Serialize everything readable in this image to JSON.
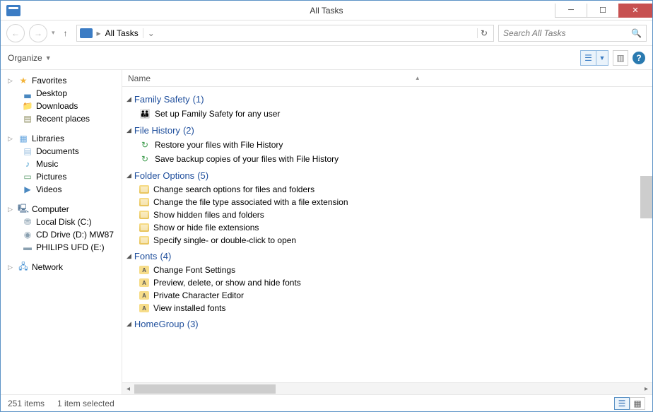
{
  "window": {
    "title": "All Tasks"
  },
  "nav": {
    "location": "All Tasks",
    "search_placeholder": "Search All Tasks"
  },
  "toolbar": {
    "organize": "Organize"
  },
  "columns": {
    "name": "Name"
  },
  "sidebar": {
    "favorites": {
      "label": "Favorites",
      "items": [
        {
          "label": "Desktop"
        },
        {
          "label": "Downloads"
        },
        {
          "label": "Recent places"
        }
      ]
    },
    "libraries": {
      "label": "Libraries",
      "items": [
        {
          "label": "Documents"
        },
        {
          "label": "Music"
        },
        {
          "label": "Pictures"
        },
        {
          "label": "Videos"
        }
      ]
    },
    "computer": {
      "label": "Computer",
      "items": [
        {
          "label": "Local Disk (C:)"
        },
        {
          "label": "CD Drive (D:) MW87"
        },
        {
          "label": "PHILIPS UFD (E:)"
        }
      ]
    },
    "network": {
      "label": "Network"
    }
  },
  "groups": [
    {
      "title": "Family Safety",
      "count": "(1)",
      "icon": "safety",
      "items": [
        {
          "label": "Set up Family Safety for any user"
        }
      ]
    },
    {
      "title": "File History",
      "count": "(2)",
      "icon": "hist",
      "items": [
        {
          "label": "Restore your files with File History"
        },
        {
          "label": "Save backup copies of your files with File History"
        }
      ]
    },
    {
      "title": "Folder Options",
      "count": "(5)",
      "icon": "fold",
      "items": [
        {
          "label": "Change search options for files and folders"
        },
        {
          "label": "Change the file type associated with a file extension"
        },
        {
          "label": "Show hidden files and folders"
        },
        {
          "label": "Show or hide file extensions"
        },
        {
          "label": "Specify single- or double-click to open"
        }
      ]
    },
    {
      "title": "Fonts",
      "count": "(4)",
      "icon": "font",
      "items": [
        {
          "label": "Change Font Settings"
        },
        {
          "label": "Preview, delete, or show and hide fonts"
        },
        {
          "label": "Private Character Editor"
        },
        {
          "label": "View installed fonts"
        }
      ]
    },
    {
      "title": "HomeGroup",
      "count": "(3)",
      "icon": "safety",
      "items": []
    }
  ],
  "status": {
    "items": "251 items",
    "selected": "1 item selected"
  }
}
